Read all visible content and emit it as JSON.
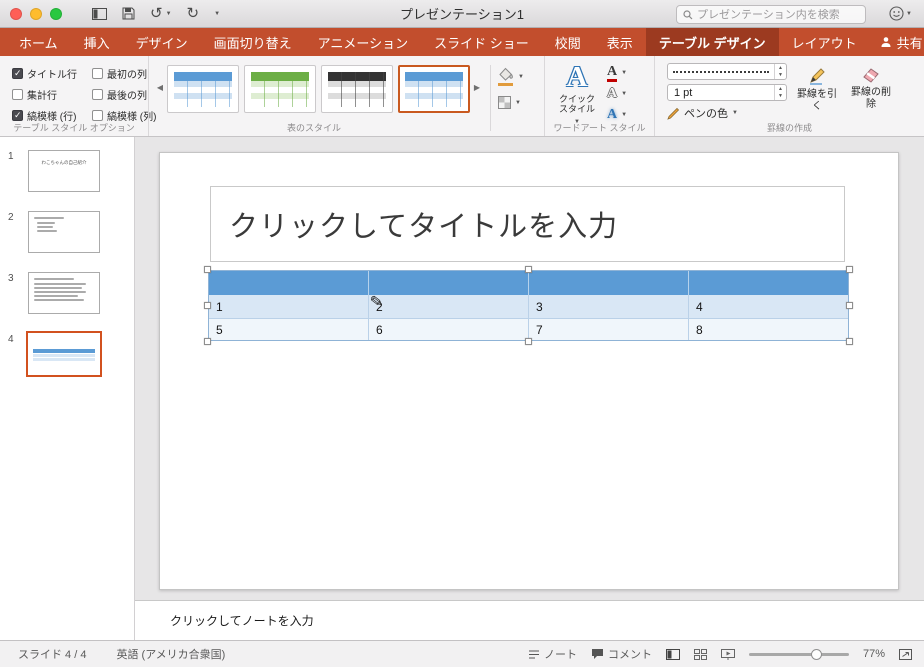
{
  "titlebar": {
    "title": "プレゼンテーション1",
    "search_placeholder": "プレゼンテーション内を検索"
  },
  "tabbar": {
    "tabs": [
      "ホーム",
      "挿入",
      "デザイン",
      "画面切り替え",
      "アニメーション",
      "スライド ショー",
      "校閲",
      "表示",
      "テーブル デザイン",
      "レイアウト"
    ],
    "active_tab": "テーブル デザイン",
    "share_label": "共有"
  },
  "ribbon": {
    "style_options": {
      "group_label": "テーブル スタイル オプション",
      "checkboxes": [
        {
          "label": "タイトル行",
          "checked": true
        },
        {
          "label": "最初の列",
          "checked": false
        },
        {
          "label": "集計行",
          "checked": false
        },
        {
          "label": "最後の列",
          "checked": false
        },
        {
          "label": "縞模様 (行)",
          "checked": true
        },
        {
          "label": "縞模様 (列)",
          "checked": false
        }
      ]
    },
    "table_styles": {
      "group_label": "表のスタイル",
      "styles": [
        {
          "name": "blue-style"
        },
        {
          "name": "green-style"
        },
        {
          "name": "black-style"
        },
        {
          "name": "blue-style",
          "selected": true
        }
      ]
    },
    "wordart": {
      "group_label": "ワードアート スタイル",
      "quick_style_label": "クイック スタイル"
    },
    "borders": {
      "group_label": "罫線の作成",
      "pen_weight": "1 pt",
      "pen_color_label": "ペンの色",
      "draw_border_label": "罫線を引く",
      "erase_border_label": "罫線の削除"
    }
  },
  "slides_panel": {
    "slides": [
      {
        "number": "1",
        "title": "わこちゃんの自己紹介"
      },
      {
        "number": "2"
      },
      {
        "number": "3"
      },
      {
        "number": "4",
        "selected": true
      }
    ]
  },
  "slide": {
    "title_placeholder": "クリックしてタイトルを入力",
    "table_rows": [
      [
        "1",
        "2",
        "3",
        "4"
      ],
      [
        "5",
        "6",
        "7",
        "8"
      ]
    ]
  },
  "notes_placeholder": "クリックしてノートを入力",
  "statusbar": {
    "slide_indicator": "スライド 4 / 4",
    "language": "英語 (アメリカ合衆国)",
    "notes_label": "ノート",
    "comments_label": "コメント",
    "zoom_percent": "77%"
  },
  "colors": {
    "ribbon_red": "#C24E2D",
    "ribbon_red_active": "#9C3A20",
    "selection_orange": "#D2511F",
    "table_header_blue": "#5B9BD5",
    "table_band_blue": "#D9E7F5"
  }
}
